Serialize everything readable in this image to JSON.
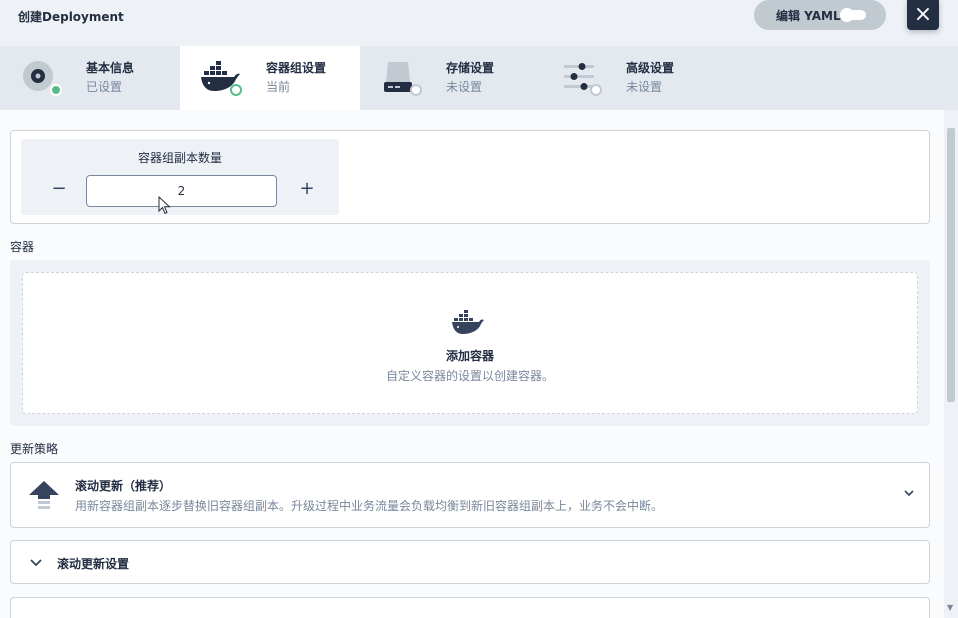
{
  "header": {
    "title": "创建Deployment",
    "yaml_label": "编辑 YAML",
    "close_icon": "×"
  },
  "tabs": [
    {
      "label": "基本信息",
      "status": "已设置",
      "icon": "disc-icon"
    },
    {
      "label": "容器组设置",
      "status": "当前",
      "icon": "docker-icon"
    },
    {
      "label": "存储设置",
      "status": "未设置",
      "icon": "storage-icon"
    },
    {
      "label": "高级设置",
      "status": "未设置",
      "icon": "sliders-icon"
    }
  ],
  "replicas": {
    "title": "容器组副本数量",
    "value": "2",
    "minus": "−",
    "plus": "+"
  },
  "containers": {
    "section_label": "容器",
    "add_title": "添加容器",
    "add_desc": "自定义容器的设置以创建容器。"
  },
  "strategy": {
    "section_label": "更新策略",
    "title": "滚动更新（推荐）",
    "desc": "用新容器组副本逐步替换旧容器组副本。升级过程中业务流量会负载均衡到新旧容器组副本上，业务不会中断。"
  },
  "rolling": {
    "title": "滚动更新设置"
  },
  "colors": {
    "primary": "#242e42",
    "success": "#55bc8a",
    "muted": "#79879c",
    "border": "#ccd3db"
  }
}
